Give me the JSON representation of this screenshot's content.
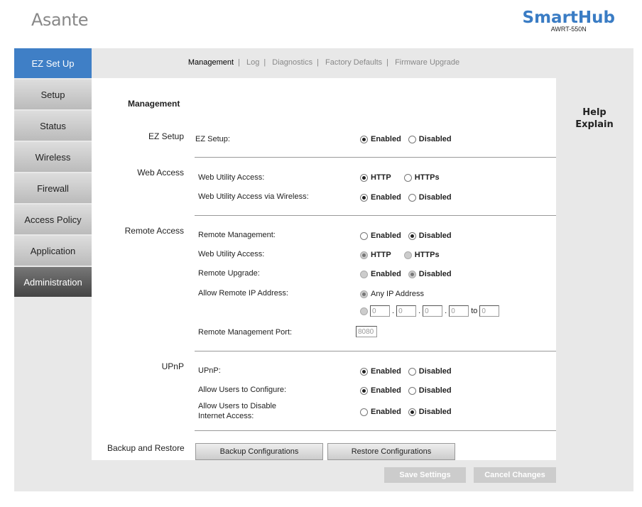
{
  "header": {
    "logo": "Asante",
    "brand": "SmartHub",
    "model": "AWRT-550N"
  },
  "sidebar": {
    "items": [
      {
        "label": "EZ Set Up"
      },
      {
        "label": "Setup"
      },
      {
        "label": "Status"
      },
      {
        "label": "Wireless"
      },
      {
        "label": "Firewall"
      },
      {
        "label": "Access Policy"
      },
      {
        "label": "Application"
      },
      {
        "label": "Administration"
      }
    ]
  },
  "tabs": [
    {
      "label": "Management"
    },
    {
      "label": "Log"
    },
    {
      "label": "Diagnostics"
    },
    {
      "label": "Factory Defaults"
    },
    {
      "label": "Firmware Upgrade"
    }
  ],
  "help": {
    "line1": "Help",
    "line2": "Explain"
  },
  "main": {
    "title": "Management",
    "sections": {
      "ez": "EZ Setup",
      "web": "Web Access",
      "remote": "Remote Access",
      "upnp": "UPnP",
      "backup": "Backup and Restore"
    },
    "rows": {
      "ez": "EZ Setup:",
      "web_access": "Web Utility Access:",
      "web_wireless": "Web Utility Access via Wireless:",
      "remote_mgmt": "Remote Management:",
      "remote_web": "Web Utility Access:",
      "remote_upgrade": "Remote Upgrade:",
      "allow_ip": "Allow Remote IP Address:",
      "port": "Remote Management Port:",
      "upnp": "UPnP:",
      "allow_config": "Allow Users to Configure:",
      "allow_disable1": "Allow Users to Disable",
      "allow_disable2": "Internet Access:"
    },
    "options": {
      "enabled": "Enabled",
      "disabled": "Disabled",
      "http": "HTTP",
      "https": "HTTPs",
      "any_ip": "Any IP Address",
      "to": "to"
    },
    "ip": {
      "a": "0",
      "b": "0",
      "c": "0",
      "d": "0",
      "e": "0"
    },
    "port_value": "8080",
    "backup_label": "Backup Configurations",
    "restore_label": "Restore Configurations"
  },
  "footer": {
    "save": "Save Settings",
    "cancel": "Cancel Changes"
  }
}
